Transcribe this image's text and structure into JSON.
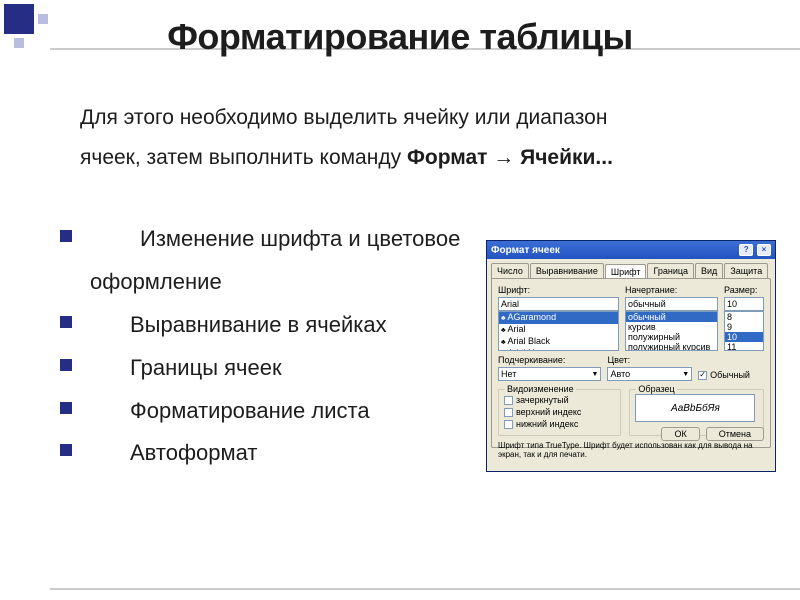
{
  "title": "Форматирование таблицы",
  "intro": {
    "line1": "Для этого необходимо выделить ячейку или диапазон",
    "line2_prefix": "ячеек, затем выполнить команду ",
    "line2_bold": "Формат → Ячейки..."
  },
  "bullets": [
    {
      "text": "Изменение шрифта и цветовое",
      "cont": "оформление"
    },
    {
      "text": "Выравнивание в ячейках"
    },
    {
      "text": "Границы ячеек"
    },
    {
      "text": "Форматирование листа"
    },
    {
      "text": "Автоформат"
    }
  ],
  "dialog": {
    "title": "Формат ячеек",
    "help": "?",
    "close": "×",
    "tabs": [
      "Число",
      "Выравнивание",
      "Шрифт",
      "Граница",
      "Вид",
      "Защита"
    ],
    "active_tab": "Шрифт",
    "labels": {
      "font": "Шрифт:",
      "style": "Начертание:",
      "size": "Размер:",
      "underline": "Подчеркивание:",
      "color": "Цвет:"
    },
    "font": {
      "value": "Arial",
      "options": [
        "AGaramond",
        "Arial",
        "Arial Black",
        "Arial Narrow"
      ]
    },
    "style": {
      "value": "обычный",
      "options": [
        "обычный",
        "курсив",
        "полужирный",
        "полужирный курсив"
      ]
    },
    "size": {
      "value": "10",
      "options": [
        "8",
        "9",
        "10",
        "11"
      ]
    },
    "underline": "Нет",
    "color": "Авто",
    "normal_chk": {
      "label": "Обычный",
      "checked": true
    },
    "effects": {
      "group": "Видоизменение",
      "items": [
        {
          "label": "зачеркнутый",
          "checked": false
        },
        {
          "label": "верхний индекс",
          "checked": false
        },
        {
          "label": "нижний индекс",
          "checked": false
        }
      ]
    },
    "sample": {
      "group": "Образец",
      "text": "АаBbБбЯя"
    },
    "hint": "Шрифт типа TrueType. Шрифт будет использован как для вывода на экран, так и для печати.",
    "buttons": {
      "ok": "ОК",
      "cancel": "Отмена"
    }
  }
}
